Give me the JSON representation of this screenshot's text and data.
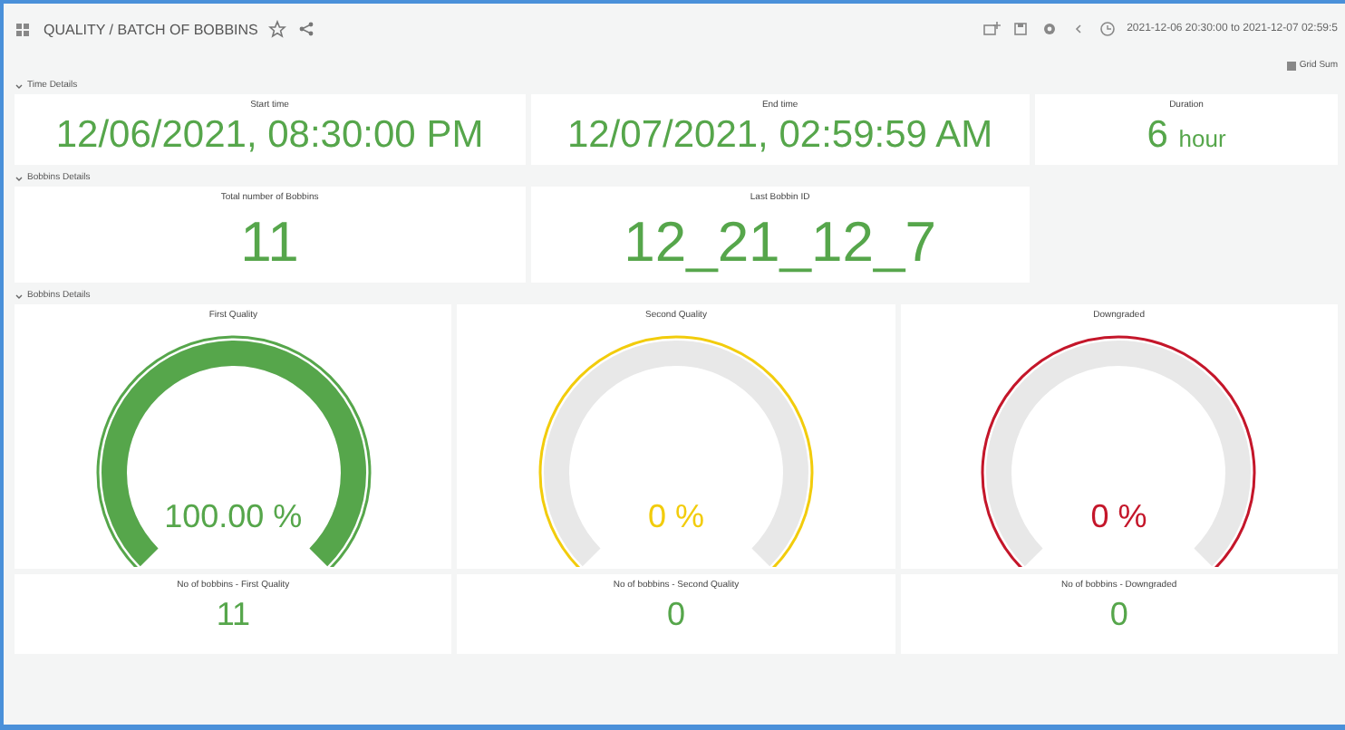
{
  "header": {
    "breadcrumb": "QUALITY / BATCH OF BOBBINS",
    "time_range": "2021-12-06 20:30:00 to 2021-12-07 02:59:5",
    "view_button": "Grid Sum"
  },
  "rows": [
    {
      "title": "Time Details",
      "panels": [
        {
          "kind": "stat",
          "title": "Start time",
          "value": "12/06/2021, 08:30:00 PM"
        },
        {
          "kind": "stat",
          "title": "End time",
          "value": "12/07/2021, 02:59:59 AM"
        },
        {
          "kind": "stat",
          "title": "Duration",
          "value": "6",
          "unit": "hour"
        }
      ]
    },
    {
      "title": "Bobbins Details",
      "panels": [
        {
          "kind": "stat",
          "title": "Total number of Bobbins",
          "value": "11",
          "big": true
        },
        {
          "kind": "stat",
          "title": "Last Bobbin ID",
          "value": "12_21_12_7",
          "big": true
        }
      ]
    },
    {
      "title": "Bobbins Details",
      "panels": [
        {
          "kind": "gauge",
          "title": "First Quality",
          "value": "100.00 %",
          "filled": true,
          "color": "#56a64b"
        },
        {
          "kind": "gauge",
          "title": "Second Quality",
          "value": "0 %",
          "filled": false,
          "color": "#f2cc0c"
        },
        {
          "kind": "gauge",
          "title": "Downgraded",
          "value": "0 %",
          "filled": false,
          "color": "#c4162a"
        },
        {
          "kind": "stat",
          "title": "No of bobbins - First Quality",
          "value": "11"
        },
        {
          "kind": "stat",
          "title": "No of bobbins - Second Quality",
          "value": "0"
        },
        {
          "kind": "stat",
          "title": "No of bobbins - Downgraded",
          "value": "0"
        }
      ]
    }
  ]
}
